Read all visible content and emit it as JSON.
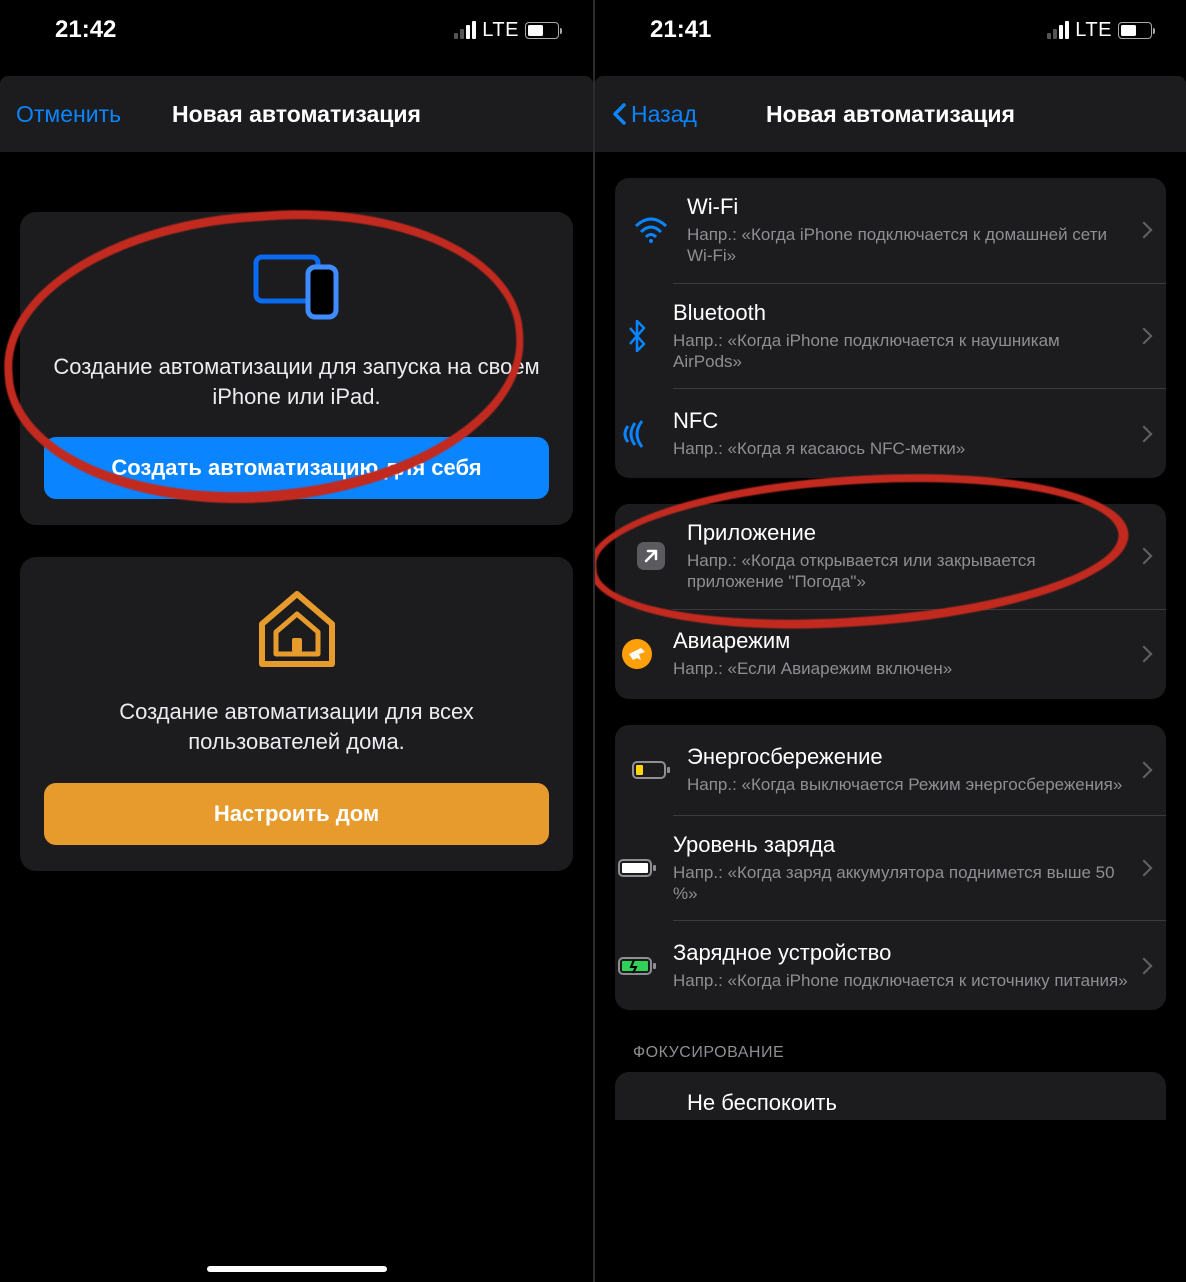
{
  "left": {
    "status": {
      "time": "21:42",
      "network": "LTE"
    },
    "nav": {
      "cancel": "Отменить",
      "title": "Новая автоматизация"
    },
    "personal": {
      "desc": "Создание автоматизации для запуска на своем iPhone или iPad.",
      "button": "Создать автоматизацию для себя"
    },
    "home": {
      "desc": "Создание автоматизации для всех пользователей дома.",
      "button": "Настроить дом"
    }
  },
  "right": {
    "status": {
      "time": "21:41",
      "network": "LTE"
    },
    "nav": {
      "back": "Назад",
      "title": "Новая автоматизация"
    },
    "groups": [
      [
        {
          "icon": "wifi",
          "title": "Wi-Fi",
          "sub": "Напр.: «Когда iPhone подключается к домашней сети Wi-Fi»"
        },
        {
          "icon": "bluetooth",
          "title": "Bluetooth",
          "sub": "Напр.: «Когда iPhone подключается к наушникам AirPods»"
        },
        {
          "icon": "nfc",
          "title": "NFC",
          "sub": "Напр.: «Когда я касаюсь NFC-метки»"
        }
      ],
      [
        {
          "icon": "app",
          "title": "Приложение",
          "sub": "Напр.: «Когда открывается или закрывается приложение \"Погода\"»"
        },
        {
          "icon": "airplane",
          "title": "Авиарежим",
          "sub": "Напр.: «Если Авиарежим включен»"
        }
      ],
      [
        {
          "icon": "lowpower",
          "title": "Энергосбережение",
          "sub": "Напр.: «Когда выключается Режим энергосбережения»"
        },
        {
          "icon": "batterylevel",
          "title": "Уровень заряда",
          "sub": "Напр.: «Когда заряд аккумулятора поднимется выше 50 %»"
        },
        {
          "icon": "charger",
          "title": "Зарядное устройство",
          "sub": "Напр.: «Когда iPhone подключается к источнику питания»"
        }
      ]
    ],
    "focus_header": "ФОКУСИРОВАНИЕ",
    "focus_partial": "Не беспокоить"
  }
}
